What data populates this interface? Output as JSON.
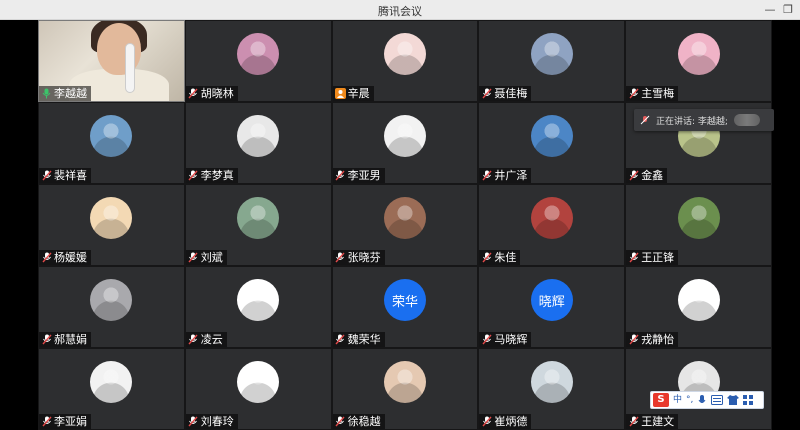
{
  "window": {
    "title": "腾讯会议",
    "minimize_icon": "minimize-icon",
    "restore_icon": "restore-icon"
  },
  "speaking_banner": {
    "label": "正在讲话: 李越越;"
  },
  "ime_toolbar": {
    "logo": "S",
    "mode": "中",
    "punct": "°,",
    "icons": [
      "mic-icon",
      "keyboard-icon",
      "shirt-icon",
      "grid-icon"
    ]
  },
  "colors": {
    "tile_bg": "#2d2e30",
    "text_avatar_blue": "#1a6ff0",
    "mic_orange": "#f08a1c"
  },
  "participants": [
    {
      "name": "李越越",
      "mic": "mic-green-icon",
      "avatar": "video",
      "self": true
    },
    {
      "name": "胡晓林",
      "mic": "mic-muted-icon",
      "avatar": "photo",
      "color": "#cc8fb0"
    },
    {
      "name": "辛晨",
      "mic": "mic-orange-icon",
      "avatar": "photo",
      "color": "#f3d9d6"
    },
    {
      "name": "聂佳梅",
      "mic": "mic-muted-icon",
      "avatar": "photo",
      "color": "#8fa3c2"
    },
    {
      "name": "主雪梅",
      "mic": "mic-muted-icon",
      "avatar": "photo",
      "color": "#f0b3c7"
    },
    {
      "name": "裴祥喜",
      "mic": "mic-muted-icon",
      "avatar": "photo",
      "color": "#6f9ec9"
    },
    {
      "name": "李梦真",
      "mic": "mic-muted-icon",
      "avatar": "photo",
      "color": "#e8e8e8"
    },
    {
      "name": "李亚男",
      "mic": "mic-muted-icon",
      "avatar": "photo",
      "color": "#f2f2f2"
    },
    {
      "name": "井广泽",
      "mic": "mic-muted-icon",
      "avatar": "photo",
      "color": "#4c86c6"
    },
    {
      "name": "金鑫",
      "mic": "mic-muted-icon",
      "avatar": "photo",
      "color": "#b9c38a"
    },
    {
      "name": "杨媛媛",
      "mic": "mic-muted-icon",
      "avatar": "photo",
      "color": "#f3d9b4"
    },
    {
      "name": "刘斌",
      "mic": "mic-muted-icon",
      "avatar": "photo",
      "color": "#86a88f"
    },
    {
      "name": "张晓芬",
      "mic": "mic-muted-icon",
      "avatar": "photo",
      "color": "#9b6c56"
    },
    {
      "name": "朱佳",
      "mic": "mic-muted-icon",
      "avatar": "photo",
      "color": "#b2433e"
    },
    {
      "name": "王正锋",
      "mic": "mic-muted-icon",
      "avatar": "photo",
      "color": "#6b8f4e"
    },
    {
      "name": "郝慧娟",
      "mic": "mic-muted-icon",
      "avatar": "photo",
      "color": "#a9a9ad"
    },
    {
      "name": "凌云",
      "mic": "mic-muted-icon",
      "avatar": "photo",
      "color": "#ffffff"
    },
    {
      "name": "魏荣华",
      "mic": "mic-muted-icon",
      "avatar": "text",
      "text": "荣华",
      "color": "#1a6ff0"
    },
    {
      "name": "马晓辉",
      "mic": "mic-muted-icon",
      "avatar": "text",
      "text": "晓辉",
      "color": "#1a6ff0"
    },
    {
      "name": "戎静怡",
      "mic": "mic-muted-icon",
      "avatar": "photo",
      "color": "#ffffff"
    },
    {
      "name": "李亚娟",
      "mic": "mic-muted-icon",
      "avatar": "photo",
      "color": "#f2f2f2"
    },
    {
      "name": "刘春玲",
      "mic": "mic-muted-icon",
      "avatar": "photo",
      "color": "#ffffff"
    },
    {
      "name": "徐稳越",
      "mic": "mic-muted-icon",
      "avatar": "photo",
      "color": "#e5c9b2"
    },
    {
      "name": "崔炳德",
      "mic": "mic-muted-icon",
      "avatar": "photo",
      "color": "#cfd8de"
    },
    {
      "name": "王建文",
      "mic": "mic-muted-icon",
      "avatar": "photo",
      "color": "#e6e6e6"
    }
  ]
}
